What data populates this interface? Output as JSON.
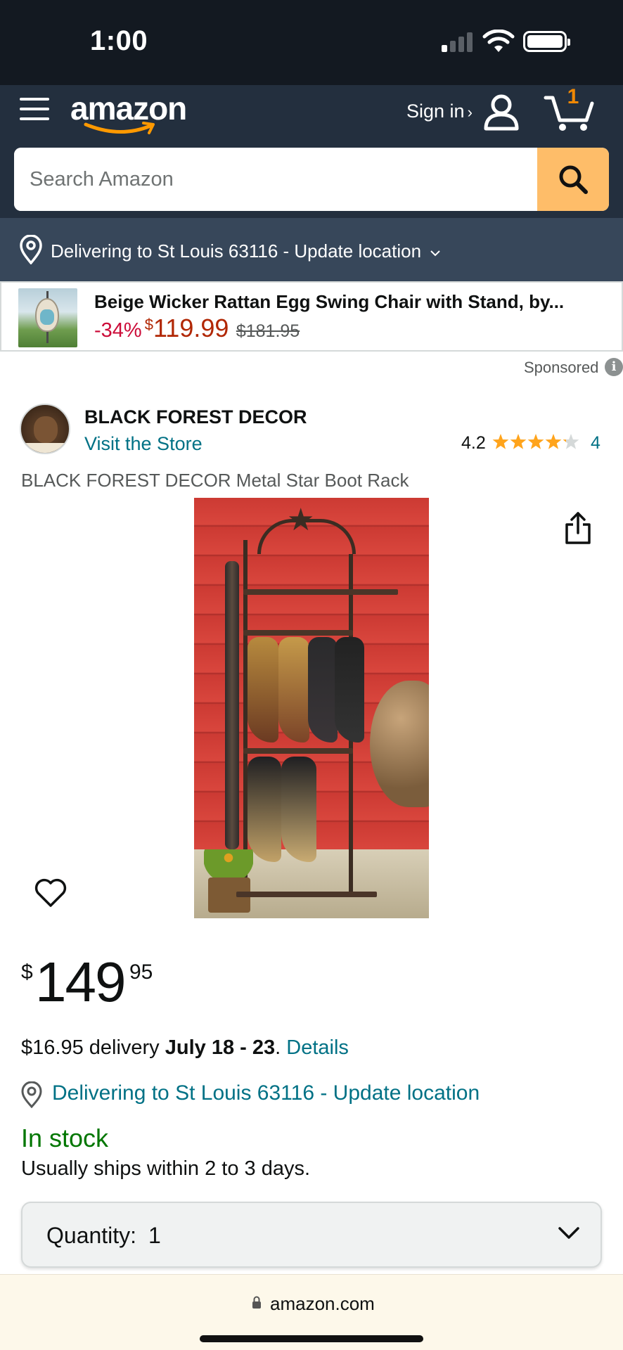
{
  "status_bar": {
    "time": "1:00"
  },
  "header": {
    "logo_text": "amazon",
    "sign_in": "Sign in",
    "sign_in_chevron": "›",
    "cart_count": "1",
    "search_placeholder": "Search Amazon"
  },
  "location_bar": {
    "text": "Delivering to St Louis 63116 - Update location"
  },
  "sponsored_ad": {
    "title": "Beige Wicker Rattan Egg Swing Chair with Stand, by...",
    "discount": "-34%",
    "currency": "$",
    "price": "119.99",
    "list_price": "$181.95",
    "sponsored_label": "Sponsored",
    "info_symbol": "i"
  },
  "brand": {
    "name": "BLACK FOREST DECOR",
    "visit_store": "Visit the Store",
    "rating": "4.2",
    "rating_value": 4.2,
    "rating_count": "4"
  },
  "product": {
    "title": "BLACK FOREST DECOR Metal Star Boot Rack",
    "price_currency": "$",
    "price_whole": "149",
    "price_fraction": "95",
    "delivery_fee": "$16.95 delivery ",
    "delivery_dates": "July 18 - 23",
    "delivery_period": ". ",
    "details_link": "Details",
    "delivering_to": "Delivering to St Louis 63116 - Update location",
    "stock_status": "In stock",
    "ships_note": "Usually ships within 2 to 3 days.",
    "quantity_label": "Quantity:",
    "quantity_value": "1"
  },
  "browser": {
    "url": "amazon.com"
  },
  "colors": {
    "header_dark": "#131921",
    "header": "#232f3e",
    "location_bar": "#37475a",
    "search_button": "#febd69",
    "link": "#007185",
    "deal_red": "#cc0c39",
    "price_red": "#b12704",
    "in_stock_green": "#007600",
    "star": "#ffa41c"
  }
}
